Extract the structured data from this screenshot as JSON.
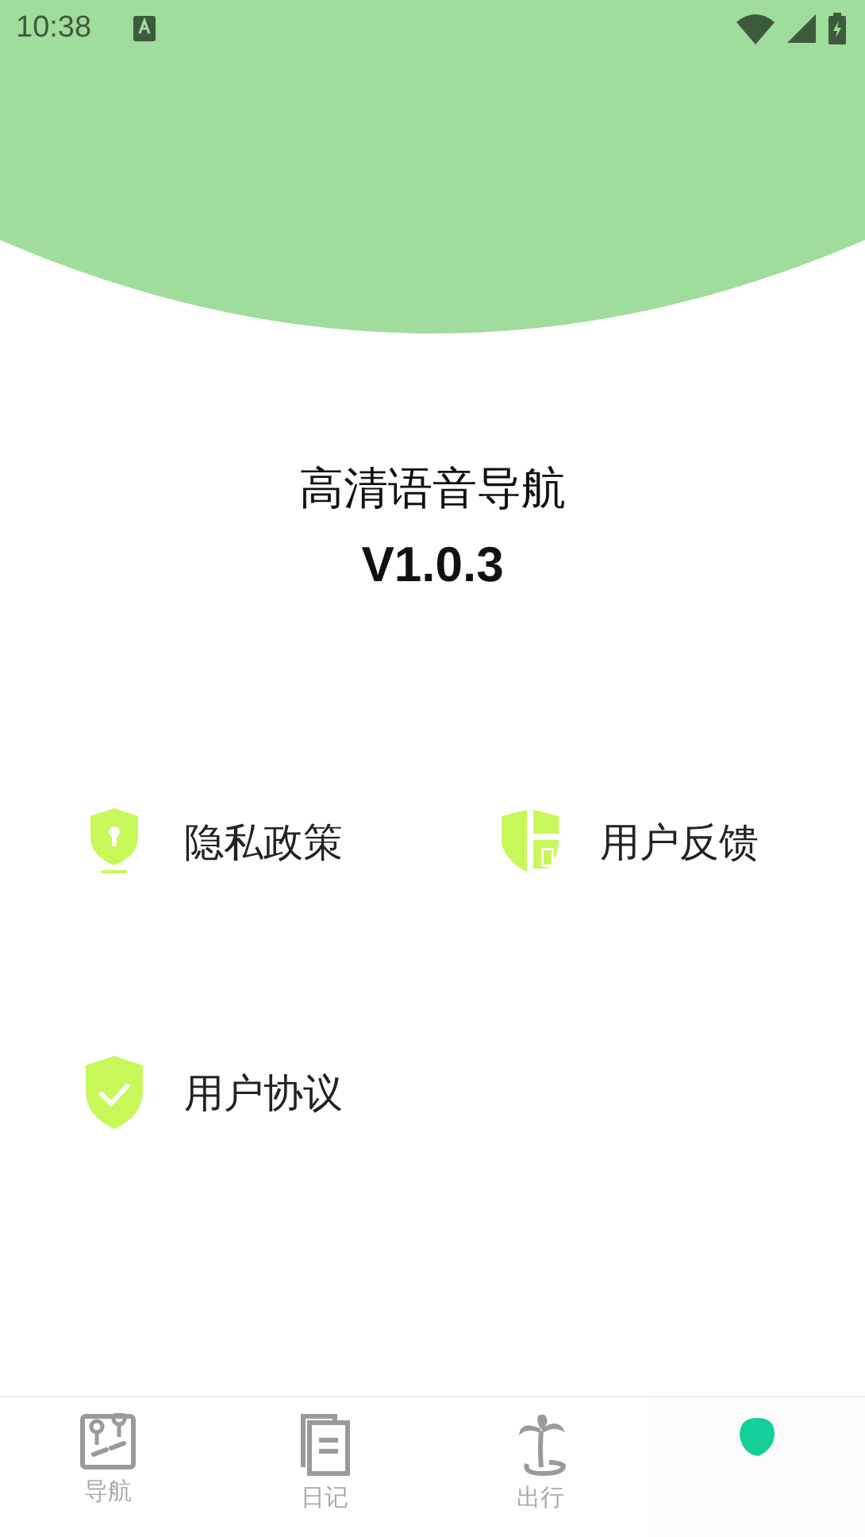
{
  "status_bar": {
    "time": "10:38"
  },
  "app": {
    "name": "高清语音导航",
    "version": "V1.0.3"
  },
  "menu": [
    {
      "label": "隐私政策",
      "kind": "privacy"
    },
    {
      "label": "用户反馈",
      "kind": "feedback"
    },
    {
      "label": "用户协议",
      "kind": "agreement"
    }
  ],
  "tabs": [
    {
      "label": "导航",
      "kind": "map",
      "selected": false
    },
    {
      "label": "日记",
      "kind": "diary",
      "selected": false
    },
    {
      "label": "出行",
      "kind": "travel",
      "selected": false
    },
    {
      "kind": "blob",
      "selected": true
    }
  ]
}
